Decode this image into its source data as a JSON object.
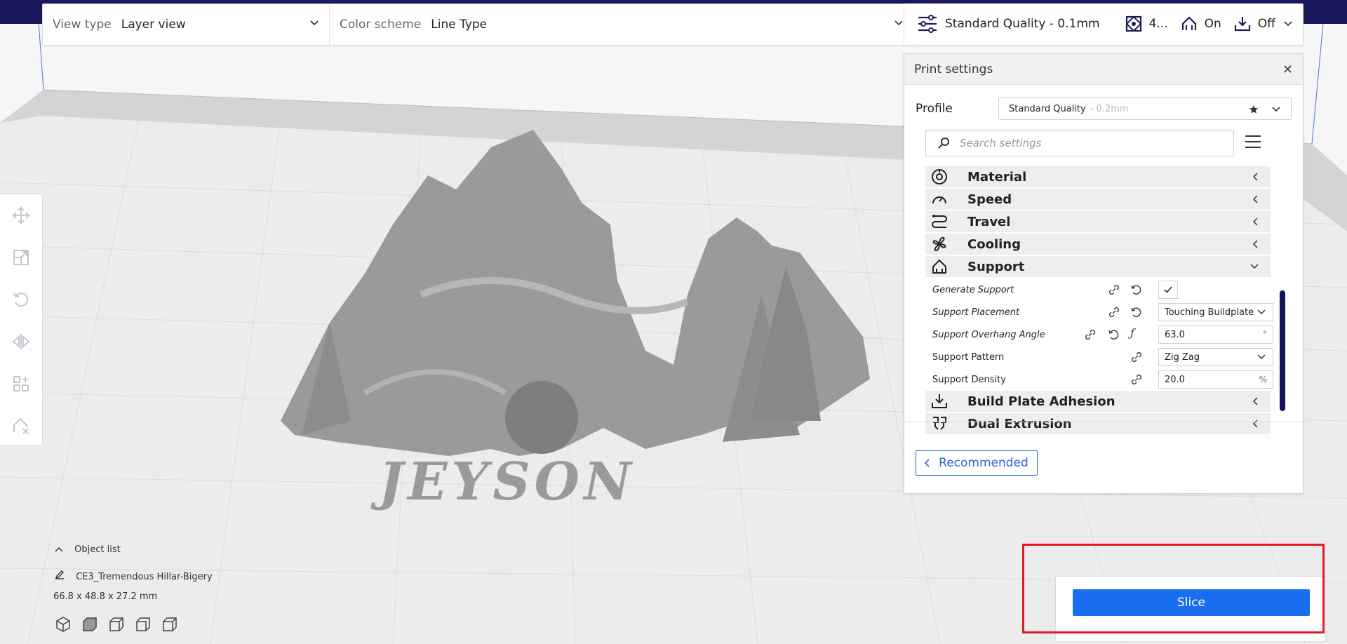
{
  "toolbar": {
    "view_type_label": "View type",
    "view_type_value": "Layer view",
    "color_scheme_label": "Color scheme",
    "color_scheme_value": "Line Type",
    "quality": "Standard Quality - 0.1mm",
    "infill": "4...",
    "support": "On",
    "adhesion": "Off"
  },
  "print_settings": {
    "title": "Print settings",
    "profile_label": "Profile",
    "profile_value": "Standard Quality",
    "profile_sub": "- 0.2mm",
    "search_placeholder": "Search settings",
    "categories_top": [
      {
        "label": "Material",
        "icon": "material-icon"
      },
      {
        "label": "Speed",
        "icon": "speed-icon"
      },
      {
        "label": "Travel",
        "icon": "travel-icon"
      },
      {
        "label": "Cooling",
        "icon": "cooling-icon"
      },
      {
        "label": "Support",
        "icon": "support-icon"
      }
    ],
    "support_settings": [
      {
        "label": "Generate Support",
        "value": ""
      },
      {
        "label": "Support Placement",
        "value": "Touching Buildplate"
      },
      {
        "label": "Support Overhang Angle",
        "value": "63.0",
        "unit": "°"
      },
      {
        "label": "Support Pattern",
        "value": "Zig Zag"
      },
      {
        "label": "Support Density",
        "value": "20.0",
        "unit": "%"
      }
    ],
    "categories_bottom": [
      {
        "label": "Build Plate Adhesion",
        "icon": "adhesion-icon"
      },
      {
        "label": "Dual Extrusion",
        "icon": "dual-extrusion-icon"
      }
    ],
    "recommended_label": "Recommended"
  },
  "object_list": {
    "header": "Object list",
    "object_name": "CE3_Tremendous Hillar-Bigery",
    "dimensions": "66.8 x 48.8 x 27.2 mm"
  },
  "model": {
    "text": "JEYSON"
  },
  "slice": {
    "label": "Slice"
  },
  "colors": {
    "accent": "#196ef0",
    "header_bar": "#19185a",
    "highlight": "#e01b24"
  }
}
